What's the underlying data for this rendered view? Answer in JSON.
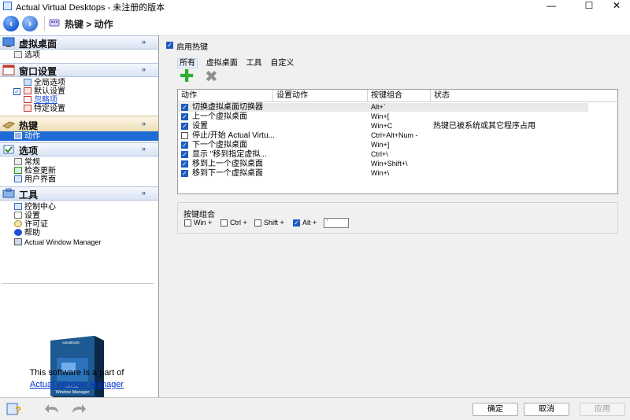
{
  "window": {
    "title": "Actual Virtual Desktops - 未注册的版本",
    "controls": {
      "minimize": "—",
      "maximize": "☐",
      "close": "✕"
    }
  },
  "nav": {
    "back": "‹",
    "forward": "›",
    "breadcrumb": "热键 > 动作"
  },
  "sidebar": {
    "sections": [
      {
        "title": "虚拟桌面",
        "chevron": "»",
        "items": [
          "选项"
        ]
      },
      {
        "title": "窗口设置",
        "chevron": "»",
        "items": [
          "全局选项",
          "默认设置",
          "忽略项",
          "特定设置"
        ]
      },
      {
        "title": "热键",
        "chevron": "»",
        "items": [
          "动作"
        ]
      },
      {
        "title": "选项",
        "chevron": "»",
        "items": [
          "常规",
          "检查更新",
          "用户界面"
        ]
      },
      {
        "title": "工具",
        "chevron": "»",
        "items": [
          "控制中心",
          "设置",
          "许可证",
          "帮助",
          "Actual Window Manager"
        ]
      }
    ],
    "promo": {
      "box_logo": "actualtools",
      "box_brand": "ACTUAL",
      "box_product": "Window Manager",
      "text": "This software is a part of",
      "link": "Actual Window Manager"
    }
  },
  "main": {
    "enable_label": "启用热键",
    "tabs": [
      "所有",
      "虚拟桌面",
      "工具",
      "自定义"
    ],
    "toolbar": {
      "add": "✚",
      "delete": "✖"
    },
    "table": {
      "columns": [
        "动作",
        "设置动作",
        "按键组合",
        "状态"
      ],
      "rows": [
        {
          "checked": true,
          "name": "切换虚拟桌面切换器",
          "key": "Alt+`",
          "status": ""
        },
        {
          "checked": true,
          "name": "上一个虚拟桌面",
          "key": "Win+[",
          "status": ""
        },
        {
          "checked": true,
          "name": "设置",
          "key": "Win+C",
          "status": "热键已被系统或其它程序占用"
        },
        {
          "checked": false,
          "name": "停止/开始 Actual Virtu...",
          "key": "Ctrl+Alt+Num -",
          "status": ""
        },
        {
          "checked": true,
          "name": "下一个虚拟桌面",
          "key": "Win+]",
          "status": ""
        },
        {
          "checked": true,
          "name": "显示 \"移到指定虚拟...",
          "key": "Ctrl+\\",
          "status": ""
        },
        {
          "checked": true,
          "name": "移到上一个虚拟桌面",
          "key": "Win+Shift+\\",
          "status": ""
        },
        {
          "checked": true,
          "name": "移到下一个虚拟桌面",
          "key": "Win+\\",
          "status": ""
        }
      ]
    },
    "hotkey_group": {
      "title": "按键组合",
      "modifiers": [
        {
          "label": "Win +",
          "checked": false
        },
        {
          "label": "Ctrl +",
          "checked": false
        },
        {
          "label": "Shift +",
          "checked": false
        },
        {
          "label": "Alt +",
          "checked": true
        }
      ],
      "key_value": "`"
    }
  },
  "footer": {
    "ok": "确定",
    "cancel": "取消",
    "apply": "应用"
  },
  "colors": {
    "accent": "#1e6bd6",
    "selected_header": "#ecdcb1",
    "link": "#0033cc"
  }
}
